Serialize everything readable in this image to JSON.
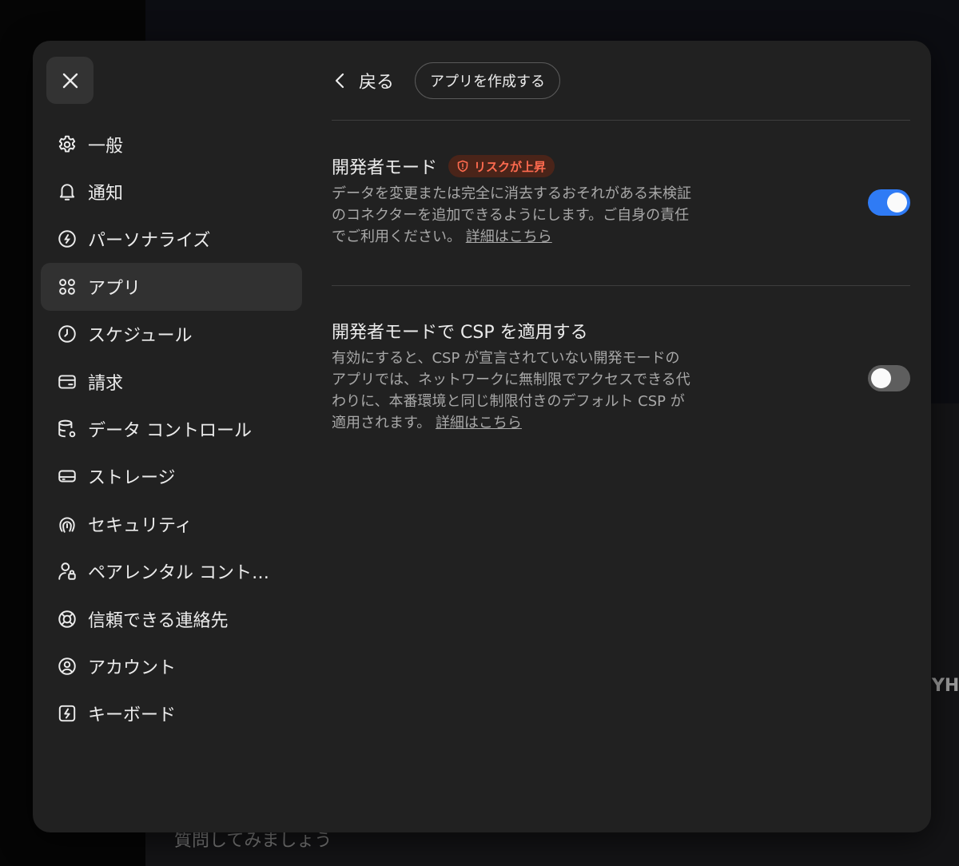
{
  "background": {
    "prompt_text": "質問してみましょう",
    "edge_text": "YHP"
  },
  "modal": {
    "close_icon": "close-icon",
    "sidebar": {
      "items": [
        {
          "label": "一般",
          "icon": "gear-icon"
        },
        {
          "label": "通知",
          "icon": "bell-icon"
        },
        {
          "label": "パーソナライズ",
          "icon": "personalize-icon"
        },
        {
          "label": "アプリ",
          "icon": "apps-grid-icon",
          "active": true
        },
        {
          "label": "スケジュール",
          "icon": "clock-icon"
        },
        {
          "label": "請求",
          "icon": "credit-card-icon"
        },
        {
          "label": "データ コントロール",
          "icon": "database-gear-icon"
        },
        {
          "label": "ストレージ",
          "icon": "storage-drive-icon"
        },
        {
          "label": "セキュリティ",
          "icon": "fingerprint-icon"
        },
        {
          "label": "ペアレンタル コント…",
          "icon": "parental-lock-icon"
        },
        {
          "label": "信頼できる連絡先",
          "icon": "lifebuoy-icon"
        },
        {
          "label": "アカウント",
          "icon": "account-circle-icon"
        },
        {
          "label": "キーボード",
          "icon": "keyboard-bolt-icon"
        }
      ]
    },
    "topbar": {
      "back_label": "戻る",
      "create_app_label": "アプリを作成する"
    },
    "settings": {
      "developer_mode": {
        "title": "開発者モード",
        "badge": "リスクが上昇",
        "desc": "データを変更または完全に消去するおそれがある未検証のコネクターを追加できるようにします。ご自身の責任でご利用ください。",
        "link": "詳細はこちら",
        "enabled": true
      },
      "csp": {
        "title": "開発者モードで CSP を適用する",
        "desc": "有効にすると、CSP が宣言されていない開発モードのアプリでは、ネットワークに無制限でアクセスできる代わりに、本番環境と同じ制限付きのデフォルト CSP が適用されます。",
        "link": "詳細はこちら",
        "enabled": false
      }
    },
    "colors": {
      "toggle_on": "#2f7bf5",
      "toggle_off": "#5e5e5e",
      "risk": "#ff6b4f"
    }
  }
}
